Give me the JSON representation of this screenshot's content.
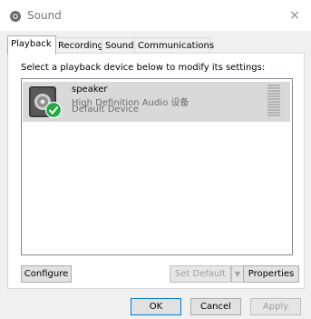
{
  "window": {
    "title": "Sound",
    "close_glyph": "×"
  },
  "tabs": [
    {
      "label": "Playback",
      "active": true
    },
    {
      "label": "Recording"
    },
    {
      "label": "Sounds"
    },
    {
      "label": "Communications"
    }
  ],
  "instruction": "Select a playback device below to modify its settings:",
  "devices": [
    {
      "name": "speaker",
      "description": "High Definition Audio 设备",
      "status": "Default Device",
      "icon": "speaker-icon",
      "badge": "default-check-icon"
    }
  ],
  "buttons": {
    "configure": "Configure",
    "set_default": "Set Default",
    "set_default_arrow": "▼",
    "properties": "Properties",
    "ok": "OK",
    "cancel": "Cancel",
    "apply": "Apply"
  },
  "colors": {
    "selection_bg": "#d9d9d9",
    "check_green": "#27a745",
    "default_button_border": "#0078d7"
  }
}
